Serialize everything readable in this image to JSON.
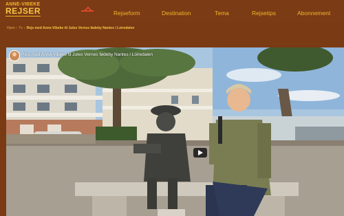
{
  "brand": {
    "line1": "ANNE-VIBEKE",
    "line2": "REJSER"
  },
  "nav": {
    "items": [
      {
        "label": "Rejseform"
      },
      {
        "label": "Destination"
      },
      {
        "label": "Tema"
      },
      {
        "label": "Rejsetips"
      },
      {
        "label": "Abonnement"
      }
    ]
  },
  "breadcrumb": {
    "home": "Hjem",
    "sep": "›",
    "section": "Tv",
    "current": "Rejs med Anne-Vibeke til Jules Vernes fødeby Nantes i Loiredalen"
  },
  "video": {
    "title": "Rejs med Anne-Vibeke til Jules Vernes fødeby Nantes i Loiredalen"
  },
  "colors": {
    "header_bg": "#7b3b15",
    "nav_text": "#f4b62b",
    "accent": "#d9482b"
  }
}
